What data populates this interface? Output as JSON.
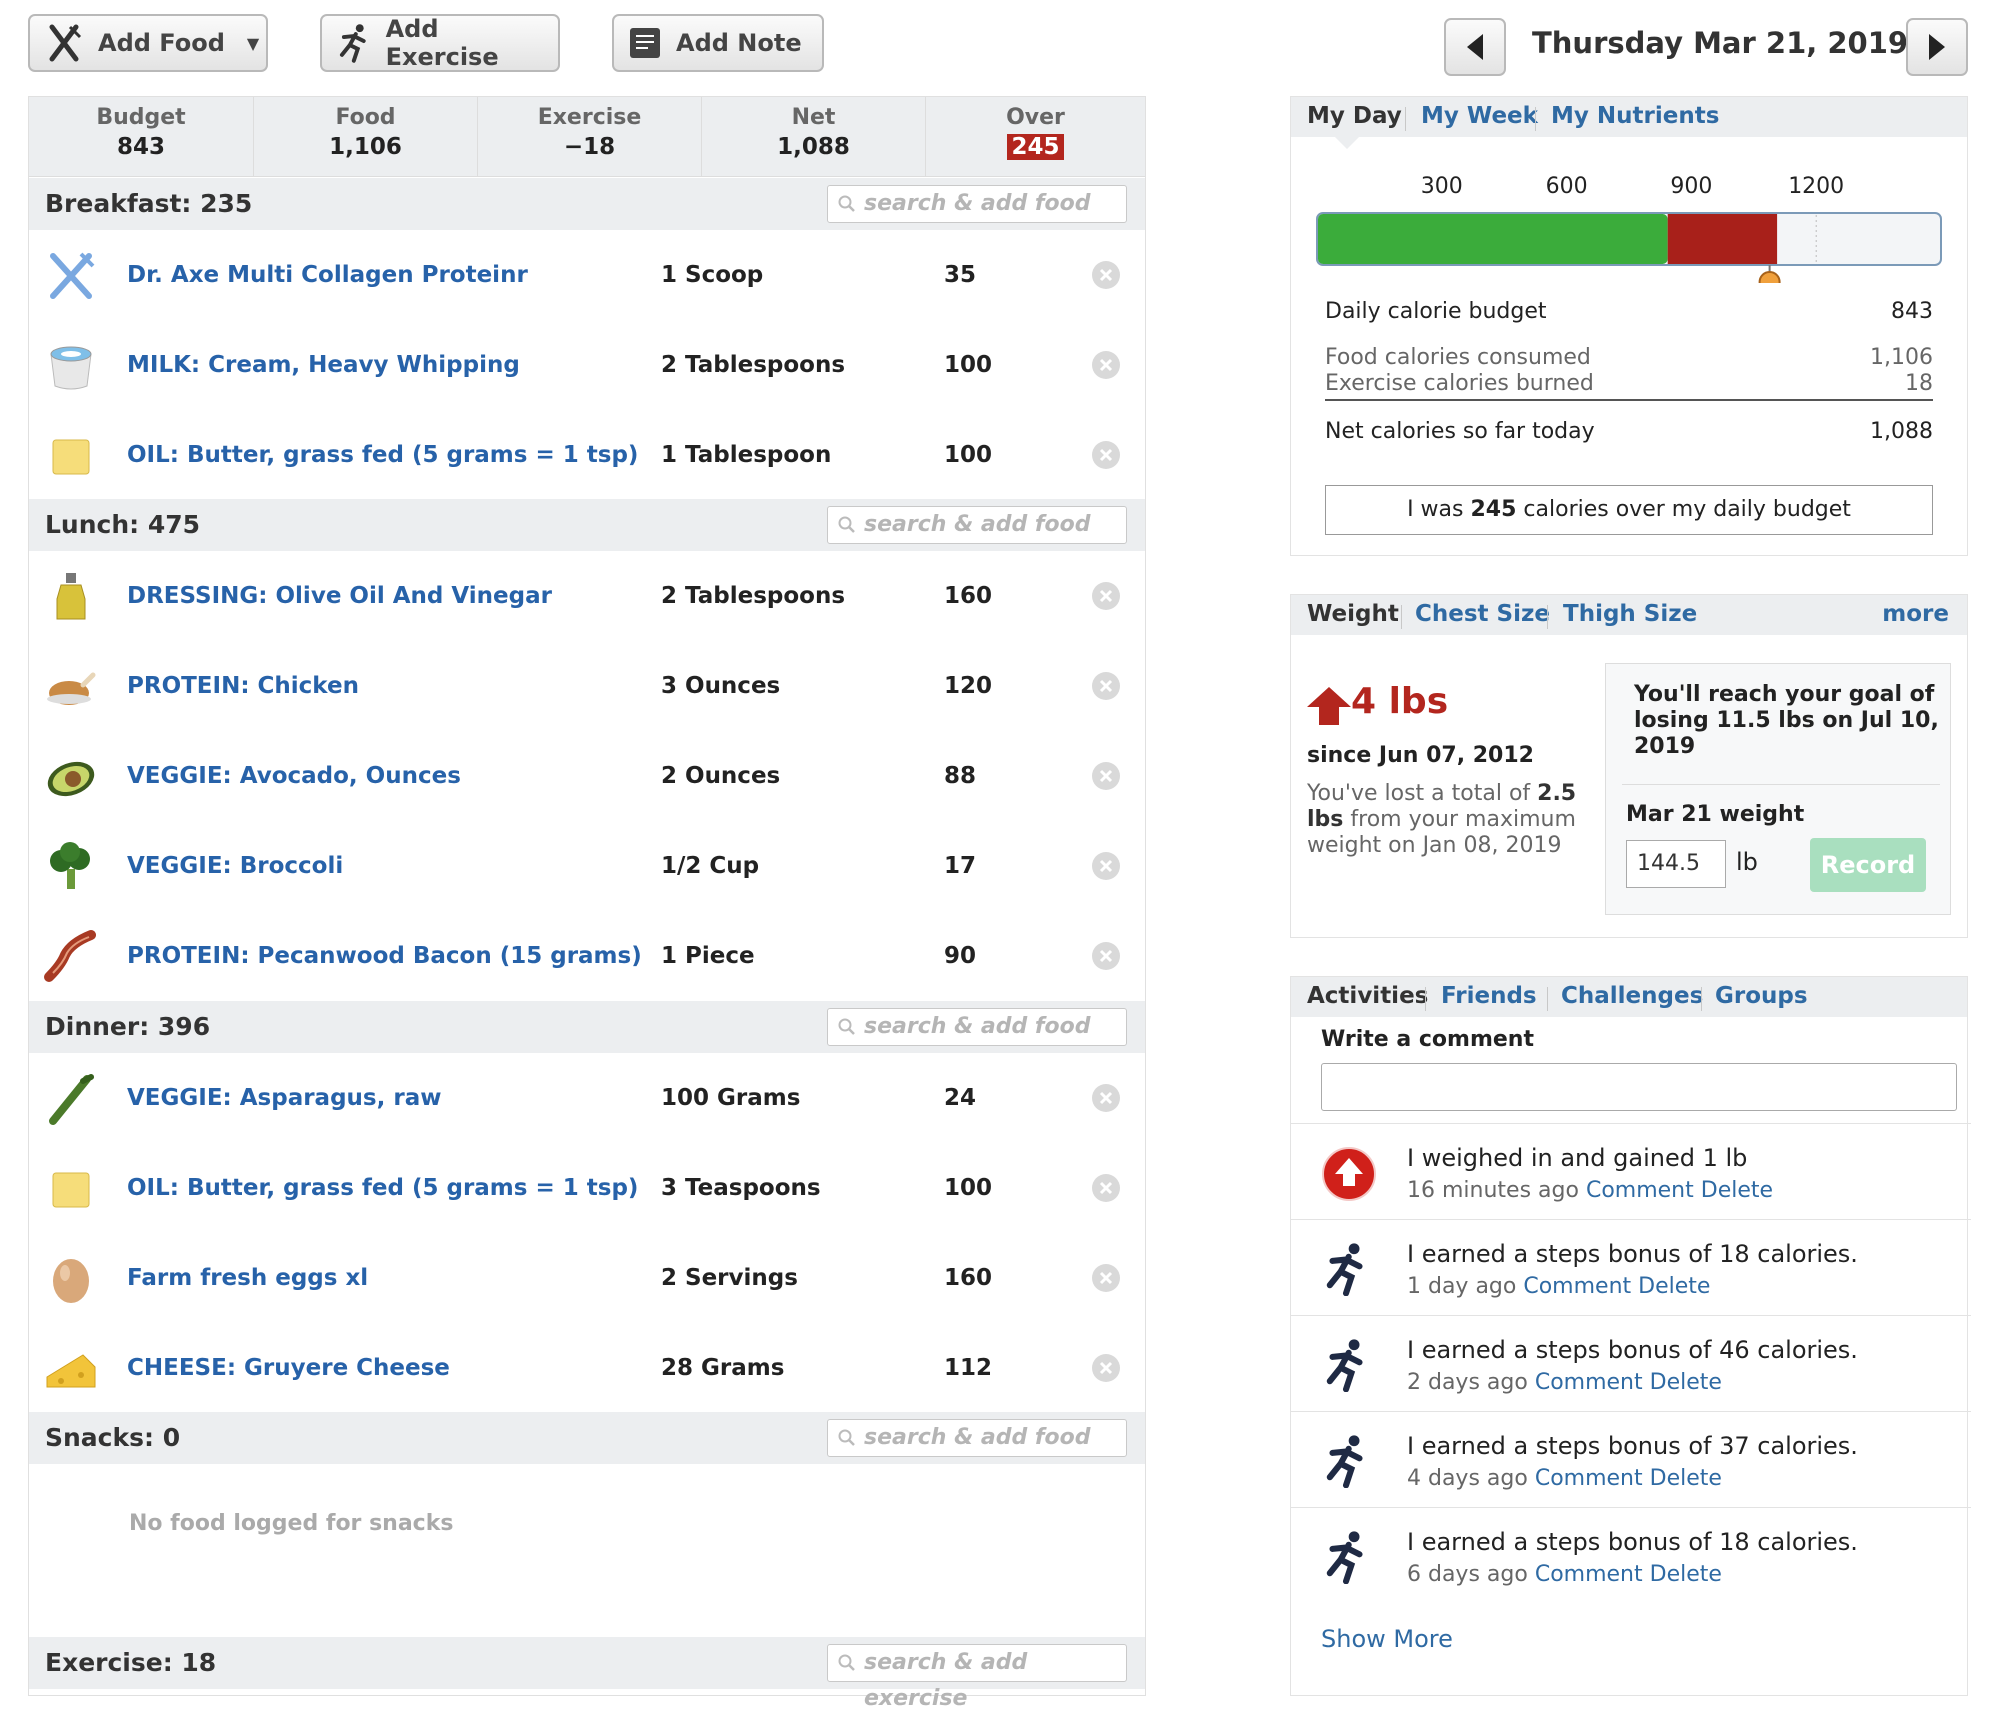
{
  "toolbar": {
    "add_food": "Add Food",
    "add_exercise": "Add Exercise",
    "add_note": "Add Note"
  },
  "date": {
    "label": "Thursday Mar 21, 2019"
  },
  "summary": [
    {
      "label": "Budget",
      "value": "843"
    },
    {
      "label": "Food",
      "value": "1,106"
    },
    {
      "label": "Exercise",
      "value": "−18"
    },
    {
      "label": "Net",
      "value": "1,088"
    },
    {
      "label": "Over",
      "value": "245"
    }
  ],
  "search_placeholder": "search & add food",
  "exercise_search_placeholder": "search & add exercise",
  "meals": {
    "breakfast": {
      "title": "Breakfast: 235",
      "items": [
        {
          "icon": "fork-knife-icon",
          "name": "Dr. Axe Multi Collagen Proteinr",
          "qty": "1 Scoop",
          "cal": "35"
        },
        {
          "icon": "milk-icon",
          "name": "MILK: Cream, Heavy Whipping",
          "qty": "2 Tablespoons",
          "cal": "100"
        },
        {
          "icon": "butter-icon",
          "name": "OIL: Butter, grass fed (5 grams = 1 tsp)",
          "qty": "1 Tablespoon",
          "cal": "100"
        }
      ]
    },
    "lunch": {
      "title": "Lunch: 475",
      "items": [
        {
          "icon": "oil-bottle-icon",
          "name": "DRESSING: Olive Oil And Vinegar",
          "qty": "2 Tablespoons",
          "cal": "160"
        },
        {
          "icon": "chicken-icon",
          "name": "PROTEIN: Chicken",
          "qty": "3 Ounces",
          "cal": "120"
        },
        {
          "icon": "avocado-icon",
          "name": "VEGGIE: Avocado, Ounces",
          "qty": "2 Ounces",
          "cal": "88"
        },
        {
          "icon": "broccoli-icon",
          "name": "VEGGIE: Broccoli",
          "qty": "1/2 Cup",
          "cal": "17"
        },
        {
          "icon": "bacon-icon",
          "name": "PROTEIN: Pecanwood Bacon (15 grams)",
          "qty": "1 Piece",
          "cal": "90"
        }
      ]
    },
    "dinner": {
      "title": "Dinner: 396",
      "items": [
        {
          "icon": "asparagus-icon",
          "name": "VEGGIE: Asparagus, raw",
          "qty": "100 Grams",
          "cal": "24"
        },
        {
          "icon": "butter-icon",
          "name": "OIL: Butter, grass fed (5 grams = 1 tsp)",
          "qty": "3 Teaspoons",
          "cal": "100"
        },
        {
          "icon": "egg-icon",
          "name": "Farm fresh eggs xl",
          "qty": "2 Servings",
          "cal": "160"
        },
        {
          "icon": "cheese-icon",
          "name": "CHEESE: Gruyere Cheese",
          "qty": "28 Grams",
          "cal": "112"
        }
      ]
    },
    "snacks": {
      "title": "Snacks: 0",
      "empty": "No food logged for snacks"
    },
    "exercise": {
      "title": "Exercise: 18"
    }
  },
  "myday": {
    "tabs": [
      "My Day",
      "My Week",
      "My Nutrients"
    ],
    "ticks": [
      "300",
      "600",
      "900",
      "1200"
    ],
    "bar": {
      "max": 1500,
      "budget": 843,
      "food": 1106,
      "net": 1088
    },
    "rows": {
      "budget_label": "Daily calorie budget",
      "budget_value": "843",
      "food_label": "Food calories consumed",
      "food_value": "1,106",
      "exercise_label": "Exercise calories burned",
      "exercise_value": "18",
      "net_label": "Net calories so far today",
      "net_value": "1,088"
    },
    "over_msg_pre": "I was ",
    "over_msg_num": "245",
    "over_msg_post": " calories over my daily budget"
  },
  "weight": {
    "tabs": [
      "Weight",
      "Chest Size",
      "Thigh Size"
    ],
    "more": "more",
    "change": "4 lbs",
    "since": "since Jun 07, 2012",
    "lost_pre": "You've lost a total of ",
    "lost_num": "2.5 lbs",
    "lost_post": " from your maximum weight on Jan 08, 2019",
    "goal": "You'll reach your goal of losing 11.5 lbs on Jul 10, 2019",
    "date_weight_label": "Mar 21 weight",
    "weight_value": "144.5",
    "unit": "lb",
    "record": "Record"
  },
  "activities": {
    "tabs": [
      "Activities",
      "Friends",
      "Challenges",
      "Groups"
    ],
    "write_comment": "Write a comment",
    "items": [
      {
        "icon": "weight-up-icon",
        "text": "I weighed in and gained 1 lb",
        "time": "16 minutes ago"
      },
      {
        "icon": "runner-icon",
        "text": "I earned a steps bonus of 18 calories.",
        "time": "1 day ago"
      },
      {
        "icon": "runner-icon",
        "text": "I earned a steps bonus of 46 calories.",
        "time": "2 days ago"
      },
      {
        "icon": "runner-icon",
        "text": "I earned a steps bonus of 37 calories.",
        "time": "4 days ago"
      },
      {
        "icon": "runner-icon",
        "text": "I earned a steps bonus of 18 calories.",
        "time": "6 days ago"
      }
    ],
    "comment": "Comment",
    "delete": "Delete",
    "show_more": "Show More"
  }
}
